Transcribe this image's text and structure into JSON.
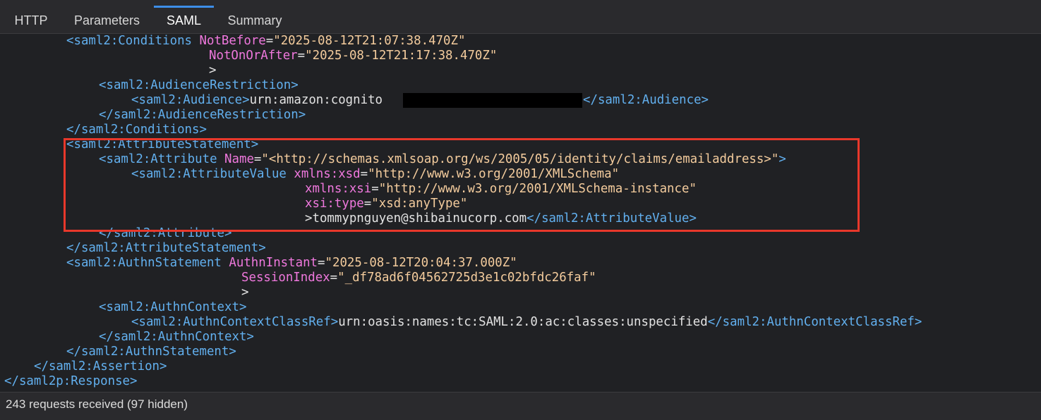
{
  "tabs": [
    {
      "label": "HTTP"
    },
    {
      "label": "Parameters"
    },
    {
      "label": "SAML"
    },
    {
      "label": "Summary"
    }
  ],
  "active_tab": "SAML",
  "lines": {
    "l1": {
      "tag": "saml2:Conditions",
      "attr": "NotBefore",
      "val": "\"2025-08-12T21:07:38.470Z\""
    },
    "l2": {
      "attr": "NotOnOrAfter",
      "val": "\"2025-08-12T21:17:38.470Z\""
    },
    "l4": {
      "tag": "saml2:AudienceRestriction"
    },
    "l5": {
      "tag_open": "saml2:Audience",
      "text": "urn:amazon:cognito",
      "tag_close": "/saml2:Audience"
    },
    "l6": {
      "tag": "/saml2:AudienceRestriction"
    },
    "l7": {
      "tag": "/saml2:Conditions"
    },
    "l8": {
      "tag": "saml2:AttributeStatement"
    },
    "l9": {
      "tag": "saml2:Attribute",
      "attr": "Name",
      "val": "\"<http://schemas.xmlsoap.org/ws/2005/05/identity/claims/emailaddress>\""
    },
    "l10": {
      "tag": "saml2:AttributeValue",
      "attr": "xmlns:xsd",
      "val": "\"http://www.w3.org/2001/XMLSchema\""
    },
    "l11": {
      "attr": "xmlns:xsi",
      "val": "\"http://www.w3.org/2001/XMLSchema-instance\""
    },
    "l12": {
      "attr": "xsi:type",
      "val": "\"xsd:anyType\""
    },
    "l13": {
      "text": "tommypnguyen@shibainucorp.com",
      "tag_close": "/saml2:AttributeValue"
    },
    "l14": {
      "tag": "/saml2:Attribute"
    },
    "l15": {
      "tag": "/saml2:AttributeStatement"
    },
    "l16": {
      "tag": "saml2:AuthnStatement",
      "attr": "AuthnInstant",
      "val": "\"2025-08-12T20:04:37.000Z\""
    },
    "l17": {
      "attr": "SessionIndex",
      "val": "\"_df78ad6f04562725d3e1c02bfdc26faf\""
    },
    "l19": {
      "tag": "saml2:AuthnContext"
    },
    "l20": {
      "tag_open": "saml2:AuthnContextClassRef",
      "text": "urn:oasis:names:tc:SAML:2.0:ac:classes:unspecified",
      "tag_close": "/saml2:AuthnContextClassRef"
    },
    "l21": {
      "tag": "/saml2:AuthnContext"
    },
    "l22": {
      "tag": "/saml2:AuthnStatement"
    },
    "l23": {
      "tag": "/saml2:Assertion"
    },
    "l24": {
      "tag": "/saml2p:Response"
    }
  },
  "status": {
    "text": "243 requests received (97 hidden)"
  },
  "colors": {
    "background": "#202124",
    "tag": "#62b0ef",
    "attribute": "#ef78dd",
    "value": "#f4cc9d",
    "text": "#e3e3e3",
    "highlight_border": "#e8382b",
    "active_tab_indicator": "#3d8ee8"
  }
}
